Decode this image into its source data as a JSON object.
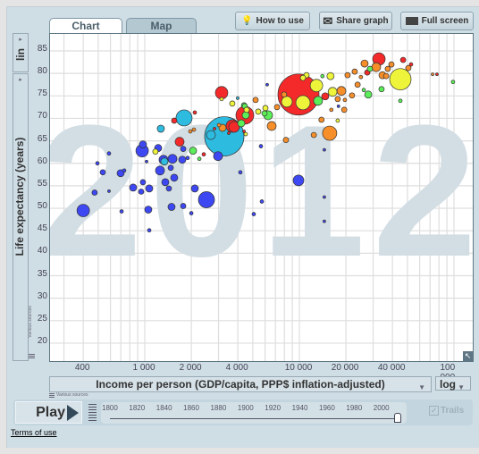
{
  "tabs": [
    {
      "label": "Chart",
      "active": true
    },
    {
      "label": "Map",
      "active": false
    }
  ],
  "toolbar": {
    "how_to_use": "How to use",
    "share_graph": "Share graph",
    "full_screen": "Full screen"
  },
  "y_axis": {
    "label": "Life expectancy (years)",
    "scale": "lin",
    "sources": "Various sources"
  },
  "x_axis": {
    "label": "Income per person (GDP/capita, PPP$ inflation-adjusted)",
    "scale": "log",
    "sources": "Various sources"
  },
  "player": {
    "play_label": "Play",
    "years": [
      "1800",
      "1820",
      "1840",
      "1860",
      "1880",
      "1900",
      "1920",
      "1940",
      "1960",
      "1980",
      "2000"
    ],
    "current_year": 2012,
    "trails_label": "Trails",
    "trails_checked": true
  },
  "footer": {
    "terms": "Terms of use"
  },
  "colors": {
    "b": "#3d48f3",
    "c": "#2ebbe0",
    "r": "#f42a2a",
    "g": "#5cee58",
    "y": "#eef43a",
    "o": "#f68e2a"
  },
  "chart_data": {
    "type": "scatter",
    "year_label": "2012",
    "xlabel": "Income per person (GDP/capita, PPP$ inflation-adjusted)",
    "ylabel": "Life expectancy (years)",
    "x_scale": "log",
    "xlim": [
      244,
      132000
    ],
    "ylim": [
      15.5,
      88.5
    ],
    "x_ticks": [
      "400",
      "1 000",
      "2 000",
      "4 000",
      "10 000",
      "20 000",
      "40 000",
      "100 000"
    ],
    "x_tick_values": [
      400,
      1000,
      2000,
      4000,
      10000,
      20000,
      40000,
      100000
    ],
    "y_ticks": [
      "85",
      "80",
      "75",
      "70",
      "65",
      "60",
      "55",
      "50",
      "45",
      "40",
      "35",
      "30",
      "25",
      "20"
    ],
    "y_tick_values": [
      85,
      80,
      75,
      70,
      65,
      60,
      55,
      50,
      45,
      40,
      35,
      30,
      25,
      20
    ],
    "grid": true,
    "size_variable": "population (millions)",
    "points": [
      [
        400,
        49.5,
        125,
        "b"
      ],
      [
        474,
        53.5,
        23,
        "b"
      ],
      [
        494,
        60.0,
        10,
        "b"
      ],
      [
        535,
        58.0,
        23,
        "b"
      ],
      [
        587,
        62.2,
        10,
        "b"
      ],
      [
        698,
        57.8,
        41,
        "b"
      ],
      [
        736,
        58.4,
        10,
        "b"
      ],
      [
        587,
        53.8,
        6,
        "b"
      ],
      [
        708,
        49.3,
        10,
        "b"
      ],
      [
        841,
        54.6,
        41,
        "b"
      ],
      [
        948,
        53.7,
        23,
        "b"
      ],
      [
        973,
        55.8,
        23,
        "b"
      ],
      [
        1069,
        54.4,
        41,
        "b"
      ],
      [
        1054,
        49.7,
        41,
        "b"
      ],
      [
        1069,
        45.1,
        10,
        "b"
      ],
      [
        962,
        62.8,
        125,
        "b"
      ],
      [
        973,
        64.2,
        41,
        "b"
      ],
      [
        1027,
        60.4,
        6,
        "b"
      ],
      [
        1221,
        63.4,
        41,
        "b"
      ],
      [
        1254,
        58.4,
        64,
        "b"
      ],
      [
        1322,
        60.8,
        64,
        "b"
      ],
      [
        1472,
        59.0,
        23,
        "b"
      ],
      [
        1511,
        61.0,
        64,
        "b"
      ],
      [
        1358,
        55.8,
        41,
        "b"
      ],
      [
        1432,
        54.4,
        23,
        "b"
      ],
      [
        1551,
        56.8,
        41,
        "b"
      ],
      [
        1490,
        50.3,
        41,
        "b"
      ],
      [
        1773,
        50.5,
        23,
        "b"
      ],
      [
        2000,
        48.9,
        10,
        "b"
      ],
      [
        1749,
        60.8,
        41,
        "b"
      ],
      [
        1894,
        61.2,
        10,
        "b"
      ],
      [
        1773,
        63.2,
        23,
        "b"
      ],
      [
        2107,
        54.4,
        41,
        "b"
      ],
      [
        2506,
        51.9,
        207,
        "b"
      ],
      [
        2978,
        61.6,
        64,
        "b"
      ],
      [
        4152,
        58.0,
        10,
        "b"
      ],
      [
        5640,
        63.8,
        10,
        "b"
      ],
      [
        5070,
        48.7,
        10,
        "b"
      ],
      [
        9870,
        56.2,
        92,
        "b"
      ],
      [
        14500,
        52.5,
        6,
        "b"
      ],
      [
        14500,
        47.1,
        6,
        "b"
      ],
      [
        5720,
        51.5,
        10,
        "b"
      ],
      [
        14500,
        63.0,
        6,
        "b"
      ],
      [
        17900,
        72.7,
        6,
        "b"
      ],
      [
        6190,
        77.5,
        6,
        "b"
      ],
      [
        3270,
        66.0,
        1237,
        "c"
      ],
      [
        2679,
        66.3,
        64,
        "c"
      ],
      [
        1795,
        70.1,
        207,
        "c"
      ],
      [
        1270,
        67.7,
        41,
        "c"
      ],
      [
        1340,
        60.4,
        41,
        "c"
      ],
      [
        3990,
        74.5,
        6,
        "c"
      ],
      [
        9870,
        75.3,
        1350,
        "r"
      ],
      [
        3141,
        75.7,
        125,
        "r"
      ],
      [
        2107,
        71.3,
        10,
        "r"
      ],
      [
        1551,
        69.5,
        23,
        "r"
      ],
      [
        1680,
        64.8,
        64,
        "r"
      ],
      [
        2408,
        62.0,
        10,
        "r"
      ],
      [
        3684,
        68.3,
        125,
        "r"
      ],
      [
        2825,
        67.7,
        6,
        "r"
      ],
      [
        3494,
        66.7,
        6,
        "r"
      ],
      [
        4385,
        67.1,
        6,
        "r"
      ],
      [
        4440,
        70.7,
        255,
        "r"
      ],
      [
        3785,
        68.1,
        92,
        "r"
      ],
      [
        14700,
        74.9,
        41,
        "r"
      ],
      [
        32700,
        83.2,
        125,
        "r"
      ],
      [
        46900,
        83.0,
        23,
        "r"
      ],
      [
        52800,
        82.0,
        10,
        "r"
      ],
      [
        77600,
        79.8,
        6,
        "r"
      ],
      [
        27500,
        80.2,
        23,
        "r"
      ],
      [
        2052,
        62.8,
        41,
        "g"
      ],
      [
        2254,
        61.0,
        10,
        "g"
      ],
      [
        4210,
        68.9,
        41,
        "g"
      ],
      [
        4500,
        70.7,
        41,
        "g"
      ],
      [
        4385,
        72.9,
        23,
        "g"
      ],
      [
        34000,
        76.5,
        23,
        "g"
      ],
      [
        45000,
        73.9,
        10,
        "g"
      ],
      [
        27900,
        75.3,
        41,
        "g"
      ],
      [
        26100,
        76.3,
        10,
        "g"
      ],
      [
        14100,
        79.4,
        10,
        "g"
      ],
      [
        13200,
        73.9,
        64,
        "g"
      ],
      [
        6280,
        70.7,
        64,
        "g"
      ],
      [
        5950,
        71.1,
        23,
        "g"
      ],
      [
        4440,
        72.7,
        23,
        "g"
      ],
      [
        28600,
        81.0,
        23,
        "g"
      ],
      [
        98600,
        78.1,
        10,
        "g"
      ],
      [
        45000,
        78.7,
        367,
        "y"
      ],
      [
        12900,
        77.3,
        125,
        "y"
      ],
      [
        16400,
        75.9,
        64,
        "y"
      ],
      [
        10550,
        73.5,
        163,
        "y"
      ],
      [
        8300,
        73.7,
        92,
        "y"
      ],
      [
        11120,
        79.6,
        23,
        "y"
      ],
      [
        10550,
        79.0,
        23,
        "y"
      ],
      [
        17700,
        69.5,
        10,
        "y"
      ],
      [
        6030,
        72.3,
        23,
        "y"
      ],
      [
        3141,
        74.3,
        10,
        "y"
      ],
      [
        3684,
        73.3,
        23,
        "y"
      ],
      [
        4560,
        71.9,
        23,
        "y"
      ],
      [
        4500,
        66.5,
        10,
        "y"
      ],
      [
        5420,
        71.5,
        23,
        "y"
      ],
      [
        15900,
        79.4,
        41,
        "y"
      ],
      [
        1172,
        62.6,
        23,
        "y"
      ],
      [
        1971,
        67.1,
        10,
        "o"
      ],
      [
        2080,
        67.5,
        10,
        "o"
      ],
      [
        3183,
        67.9,
        41,
        "o"
      ],
      [
        3020,
        68.5,
        10,
        "o"
      ],
      [
        5210,
        74.1,
        23,
        "o"
      ],
      [
        15700,
        66.7,
        163,
        "o"
      ],
      [
        18700,
        76.1,
        64,
        "o"
      ],
      [
        20500,
        79.6,
        23,
        "o"
      ],
      [
        22800,
        80.4,
        23,
        "o"
      ],
      [
        23800,
        77.5,
        23,
        "o"
      ],
      [
        25000,
        79.2,
        10,
        "o"
      ],
      [
        26400,
        82.2,
        41,
        "o"
      ],
      [
        31400,
        81.4,
        64,
        "o"
      ],
      [
        34500,
        79.6,
        41,
        "o"
      ],
      [
        37300,
        81.0,
        23,
        "o"
      ],
      [
        39400,
        82.0,
        23,
        "o"
      ],
      [
        50700,
        81.2,
        23,
        "o"
      ],
      [
        17700,
        74.3,
        23,
        "o"
      ],
      [
        19700,
        74.1,
        10,
        "o"
      ],
      [
        19500,
        71.9,
        23,
        "o"
      ],
      [
        16100,
        71.9,
        10,
        "o"
      ],
      [
        21900,
        75.1,
        23,
        "o"
      ],
      [
        12400,
        66.3,
        23,
        "o"
      ],
      [
        13900,
        69.7,
        23,
        "o"
      ],
      [
        8190,
        65.2,
        23,
        "o"
      ],
      [
        6620,
        68.3,
        64,
        "o"
      ],
      [
        7170,
        72.5,
        23,
        "o"
      ],
      [
        7970,
        75.3,
        23,
        "o"
      ],
      [
        72700,
        79.8,
        6,
        "o"
      ],
      [
        36400,
        79.4,
        23,
        "o"
      ]
    ]
  }
}
